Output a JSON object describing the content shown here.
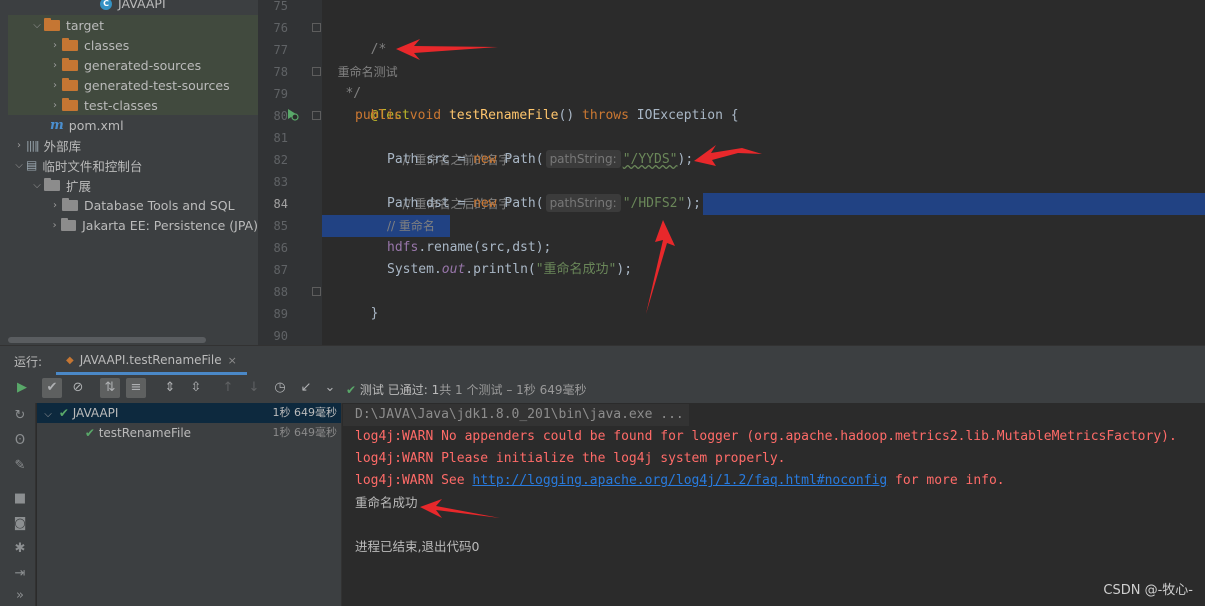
{
  "project_tree": {
    "root_label": "JAVAAPI",
    "items": [
      {
        "label": "target",
        "expanded": true
      },
      {
        "label": "classes"
      },
      {
        "label": "generated-sources"
      },
      {
        "label": "generated-test-sources"
      },
      {
        "label": "test-classes"
      },
      {
        "label": "pom.xml"
      },
      {
        "label": "外部库"
      },
      {
        "label": "临时文件和控制台"
      },
      {
        "label": "扩展"
      },
      {
        "label": "Database Tools and SQL"
      },
      {
        "label": "Jakarta EE: Persistence (JPA)"
      }
    ]
  },
  "editor": {
    "line_numbers": [
      "75",
      "76",
      "77",
      "78",
      "79",
      "80",
      "81",
      "82",
      "83",
      "84",
      "85",
      "86",
      "87",
      "88",
      "89",
      "90"
    ],
    "comment_open": "/*",
    "comment_text": "重命名测试",
    "comment_close": " */",
    "annotation": "@Test",
    "kw_public": "public",
    "kw_void": "void",
    "method_name": "testRenameFile",
    "parens": "()",
    "kw_throws": "throws",
    "exception": "IOException",
    "brace_open": "{",
    "comment_before": "// 重命名之前的名字",
    "type_path": "Path",
    "var_src": "src",
    "eq": "=",
    "kw_new": "new",
    "ctor": "Path(",
    "param_hint": "pathString:",
    "str_src": "\"/YYDS\"",
    "ctor_close": ");",
    "comment_after": "// 重命名之后的名字",
    "var_dst": "dst",
    "str_dst": "\"/HDFS2\"",
    "comment_rename": "// 重命名",
    "field_hdfs": "hdfs",
    "rename_call": ".rename(src,dst);",
    "system": "System.",
    "field_out": "out",
    "println": ".println(",
    "str_success": "\"重命名成功\"",
    "brace_close": "}"
  },
  "run_window": {
    "label": "运行:",
    "tab_title": "JAVAAPI.testRenameFile",
    "tab_close": "×",
    "status_prefix": "测试 已通过:",
    "status_passed": "1",
    "status_total": "共 1 个测试",
    "status_time": "– 1秒 649毫秒",
    "test_tree": [
      {
        "label": "JAVAAPI",
        "time": "1秒 649毫秒"
      },
      {
        "label": "testRenameFile",
        "time": "1秒 649毫秒"
      }
    ]
  },
  "console": {
    "command": "D:\\JAVA\\Java\\jdk1.8.0_201\\bin\\java.exe ...",
    "warn1": "log4j:WARN No appenders could be found for logger (org.apache.hadoop.metrics2.lib.MutableMetricsFactory).",
    "warn2": "log4j:WARN Please initialize the log4j system properly.",
    "warn3_prefix": "log4j:WARN See ",
    "warn3_link": "http://logging.apache.org/log4j/1.2/faq.html#noconfig",
    "warn3_suffix": " for more info.",
    "output": "重命名成功",
    "exit": "进程已结束,退出代码0"
  },
  "watermark": "CSDN @-牧心-",
  "colors": {
    "accent": "#4a88c7",
    "success": "#59a869",
    "error": "#ff6b68",
    "selection": "#214283",
    "arrow": "#e8282b"
  },
  "icons": [
    "run-icon",
    "check-icon",
    "stop-icon",
    "sort-icon",
    "expand-icon",
    "collapse-icon",
    "up-icon",
    "down-icon",
    "history-icon",
    "export-icon",
    "bulb-icon",
    "wrench-icon",
    "camera-icon",
    "bug-icon"
  ]
}
